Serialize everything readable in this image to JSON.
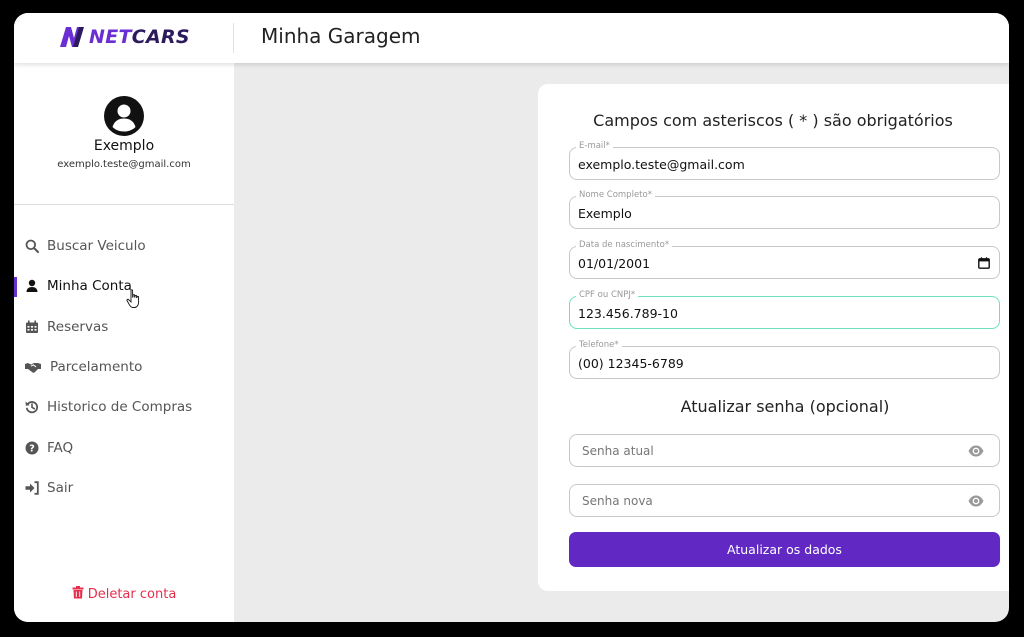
{
  "header": {
    "logo_prefix": "NET",
    "logo_suffix": "CARS",
    "title": "Minha Garagem"
  },
  "profile": {
    "name": "Exemplo",
    "email": "exemplo.teste@gmail.com",
    "avatar_icon": "user-circle-icon"
  },
  "sidebar": {
    "items": [
      {
        "label": "Buscar Veiculo",
        "icon": "search-icon"
      },
      {
        "label": "Minha Conta",
        "icon": "user-icon",
        "active": true
      },
      {
        "label": "Reservas",
        "icon": "calendar-icon"
      },
      {
        "label": "Parcelamento",
        "icon": "handshake-icon"
      },
      {
        "label": "Historico de Compras",
        "icon": "history-icon"
      },
      {
        "label": "FAQ",
        "icon": "question-icon"
      },
      {
        "label": "Sair",
        "icon": "sign-out-icon"
      }
    ],
    "delete_label": "Deletar conta"
  },
  "form": {
    "title": "Campos com asteriscos ( * ) são obrigatórios",
    "email": {
      "label": "E-mail*",
      "value": "exemplo.teste@gmail.com"
    },
    "name": {
      "label": "Nome Completo*",
      "value": "Exemplo"
    },
    "birthdate": {
      "label": "Data de nascimento*",
      "value": "01/01/2001"
    },
    "document": {
      "label": "CPF ou CNPJ*",
      "value": "123.456.789-10"
    },
    "phone": {
      "label": "Telefone*",
      "value": "(00) 12345-6789"
    },
    "password_section_title": "Atualizar senha (opcional)",
    "current_password_placeholder": "Senha atual",
    "new_password_placeholder": "Senha nova",
    "submit_label": "Atualizar os dados"
  },
  "colors": {
    "accent": "#6128c4",
    "danger": "#e5304d",
    "focus": "#6ee0c0"
  }
}
